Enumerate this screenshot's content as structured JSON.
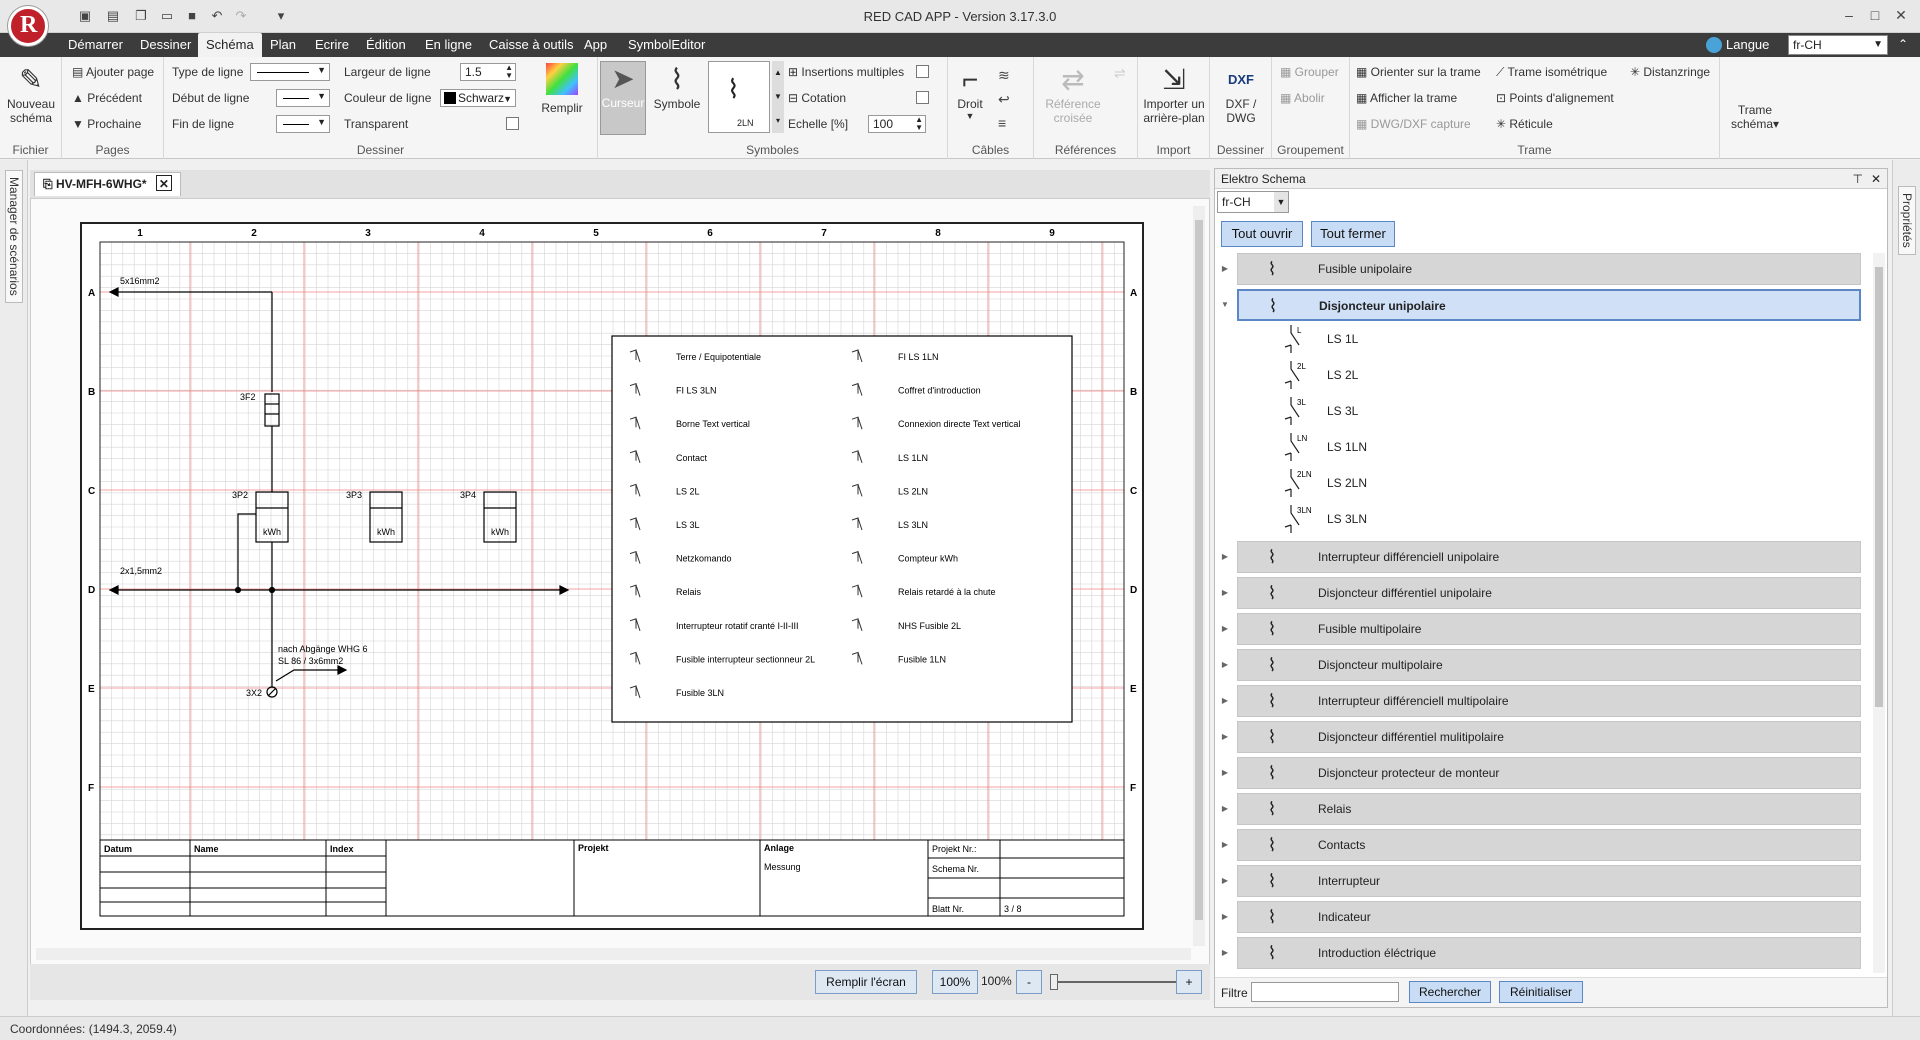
{
  "app": {
    "title": "RED CAD APP - Version 3.17.3.0",
    "logo_letter": "R"
  },
  "menu": {
    "tabs": [
      "Démarrer",
      "Dessiner",
      "Schéma",
      "Plan",
      "Ecrire",
      "Édition",
      "En ligne",
      "Caisse à outils",
      "App",
      "SymbolEditor"
    ],
    "active": "Schéma",
    "language_label": "Langue",
    "language_value": "fr-CH"
  },
  "ribbon": {
    "fichier": {
      "label": "Fichier",
      "new_schema": "Nouveau schéma"
    },
    "pages": {
      "label": "Pages",
      "add": "Ajouter page",
      "prev": "Précédent",
      "next": "Prochaine"
    },
    "dessiner": {
      "label": "Dessiner",
      "line_type": "Type de ligne",
      "line_start": "Début de ligne",
      "line_end": "Fin de ligne",
      "line_width": "Largeur de ligne",
      "line_width_value": "1.5",
      "line_color": "Couleur de ligne",
      "line_color_value": "Schwarz",
      "transparent": "Transparent",
      "fill": "Remplir"
    },
    "symboles": {
      "label": "Symboles",
      "cursor": "Curseur",
      "symbol": "Symbole",
      "multi_insert": "Insertions multiples",
      "dimension": "Cotation",
      "scale": "Echelle [%]",
      "scale_value": "100",
      "preview_label": "2LN"
    },
    "cables": {
      "label": "Câbles",
      "straight": "Droit"
    },
    "references": {
      "label": "Références",
      "cross_ref": "Référence croisée"
    },
    "import": {
      "label": "Import",
      "background": "Importer un arrière-plan"
    },
    "dessiner2": {
      "label": "Dessiner",
      "dxf": "DXF / DWG",
      "dxf_badge": "DXF"
    },
    "groupement": {
      "label": "Groupement",
      "group": "Grouper",
      "ungroup": "Abolir"
    },
    "trame": {
      "label": "Trame",
      "orient": "Orienter sur la trame",
      "show": "Afficher la trame",
      "capture": "DWG/DXF capture",
      "iso": "Trame isométrique",
      "align_points": "Points d'alignement",
      "reticle": "Réticule",
      "distance": "Distanzringe",
      "schema_grid": "Trame schéma"
    }
  },
  "left_strip": {
    "label": "Manager de scénarios"
  },
  "right_strip": {
    "label": "Propriétés"
  },
  "document": {
    "tab_label": "HV-MFH-6WHG*",
    "columns": [
      "1",
      "2",
      "3",
      "4",
      "5",
      "6",
      "7",
      "8",
      "9"
    ],
    "rows": [
      "A",
      "B",
      "C",
      "D",
      "E",
      "F"
    ],
    "cable1": "5x16mm2",
    "cable2": "2x1,5mm2",
    "feeder_note1": "nach Abgänge WHG 6",
    "feeder_note2": "SL 86 / 3x6mm2",
    "fuse_label": "3F2",
    "meters": [
      {
        "id": "3P2",
        "unit": "kWh"
      },
      {
        "id": "3P3",
        "unit": "kWh"
      },
      {
        "id": "3P4",
        "unit": "kWh"
      }
    ],
    "terminal": "3X2",
    "legend_left": [
      "Terre / Equipotentiale",
      "FI LS 3LN",
      "Borne Text vertical",
      "Contact",
      "LS 2L",
      "LS 3L",
      "Netzkomando",
      "Relais",
      "Interrupteur rotatif cranté I-II-III",
      "Fusible interrupteur sectionneur 2L",
      "Fusible 3LN"
    ],
    "legend_right": [
      "FI LS 1LN",
      "Coffret d'introduction",
      "Connexion directe Text vertical",
      "LS 1LN",
      "LS 2LN",
      "LS 3LN",
      "Compteur kWh",
      "Relais retardé à la chute",
      "NHS Fusible 2L",
      "Fusible 1LN"
    ],
    "titleblock": {
      "datum": "Datum",
      "name": "Name",
      "index": "Index",
      "projekt": "Projekt",
      "anlage": "Anlage",
      "anlage_value": "Messung",
      "projekt_nr": "Projekt Nr.:",
      "schema_nr": "Schema Nr.",
      "blatt_nr": "Blatt Nr.",
      "blatt_value": "3 / 8"
    }
  },
  "zoombar": {
    "fit": "Remplir l'écran",
    "zoom_btn": "100%",
    "zoom_value": "100%",
    "minus": "-",
    "plus": "+"
  },
  "status": {
    "coords": "Coordonnées: (1494.3, 2059.4)"
  },
  "panel": {
    "title": "Elektro Schema",
    "language": "fr-CH",
    "open_all": "Tout ouvrir",
    "close_all": "Tout fermer",
    "items": [
      {
        "label": "Fusible unipolaire",
        "expanded": false
      },
      {
        "label": "Disjoncteur unipolaire",
        "expanded": true,
        "selected": true,
        "children": [
          {
            "label": "LS 1L",
            "tag": "L"
          },
          {
            "label": "LS 2L",
            "tag": "2L"
          },
          {
            "label": "LS 3L",
            "tag": "3L"
          },
          {
            "label": "LS 1LN",
            "tag": "LN"
          },
          {
            "label": "LS 2LN",
            "tag": "2LN"
          },
          {
            "label": "LS 3LN",
            "tag": "3LN"
          }
        ]
      },
      {
        "label": "Interrupteur différenciell unipolaire"
      },
      {
        "label": "Disjoncteur différentiel unipolaire"
      },
      {
        "label": "Fusible multipolaire"
      },
      {
        "label": "Disjoncteur multipolaire"
      },
      {
        "label": "Interrupteur différenciell multipolaire"
      },
      {
        "label": "Disjoncteur différentiel mulitipolaire"
      },
      {
        "label": "Disjoncteur protecteur de monteur"
      },
      {
        "label": "Relais"
      },
      {
        "label": "Contacts"
      },
      {
        "label": "Interrupteur"
      },
      {
        "label": "Indicateur"
      },
      {
        "label": "Introduction éléctrique"
      }
    ],
    "filter_label": "Filtre",
    "search": "Rechercher",
    "reset": "Réinitialiser"
  }
}
